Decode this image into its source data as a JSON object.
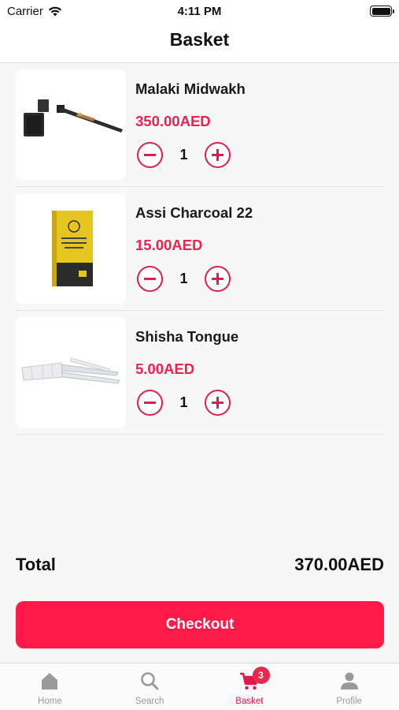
{
  "status_bar": {
    "carrier": "Carrier",
    "time": "4:11 PM"
  },
  "nav": {
    "title": "Basket"
  },
  "items": [
    {
      "name": "Malaki Midwakh",
      "price": "350.00AED",
      "quantity": "1",
      "image_icon": "midwakh-pipe-image"
    },
    {
      "name": "Assi Charcoal 22",
      "price": "15.00AED",
      "quantity": "1",
      "image_icon": "charcoal-box-image"
    },
    {
      "name": "Shisha Tongue",
      "price": "5.00AED",
      "quantity": "1",
      "image_icon": "shisha-tongue-image"
    }
  ],
  "summary": {
    "total_label": "Total",
    "total_value": "370.00AED"
  },
  "checkout": {
    "label": "Checkout"
  },
  "tab_bar": {
    "tabs": [
      {
        "label": "Home",
        "icon": "home-icon"
      },
      {
        "label": "Search",
        "icon": "search-icon"
      },
      {
        "label": "Basket",
        "icon": "cart-icon",
        "badge": "3",
        "active": true
      },
      {
        "label": "Profile",
        "icon": "person-icon"
      }
    ]
  },
  "colors": {
    "accent": "#ff1a4a",
    "price": "#f0214f",
    "tab_inactive": "#999999"
  }
}
